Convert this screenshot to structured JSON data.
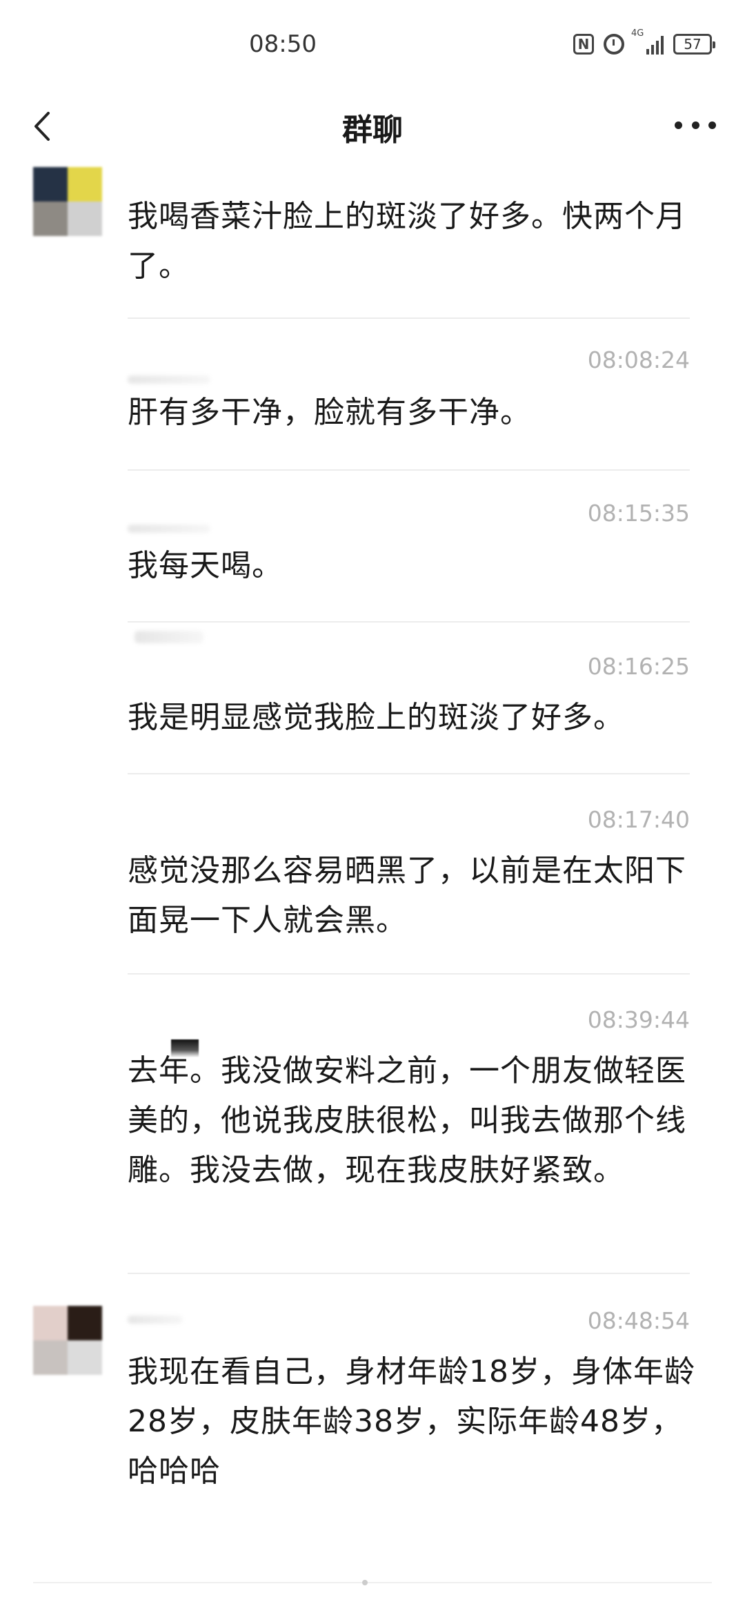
{
  "status_bar": {
    "time": "08:50",
    "nfc_label": "N",
    "network_label": "4G",
    "battery": "57"
  },
  "nav": {
    "title": "群聊",
    "back_icon": "chevron-left-icon",
    "more_icon": "more-dots-icon"
  },
  "messages": [
    {
      "time": "",
      "text": "我喝香菜汁脸上的斑淡了好多。快两个月了。",
      "avatar_colors": [
        "#253245",
        "#e3d64a",
        "#8e8a84",
        "#d0d0d0"
      ]
    },
    {
      "time": "08:08:24",
      "text": "肝有多干净，脸就有多干净。"
    },
    {
      "time": "08:15:35",
      "text": "我每天喝。"
    },
    {
      "time": "08:16:25",
      "text": "我是明显感觉我脸上的斑淡了好多。"
    },
    {
      "time": "08:17:40",
      "text": "感觉没那么容易晒黑了，以前是在太阳下面晃一下人就会黑。"
    },
    {
      "time": "08:39:44",
      "text": "去年。我没做安料之前，一个朋友做轻医美的，他说我皮肤很松，叫我去做那个线雕。我没去做，现在我皮肤好紧致。"
    },
    {
      "time": "08:48:54",
      "text": "我现在看自己，身材年龄18岁，身体年龄28岁，皮肤年龄38岁，实际年龄48岁，哈哈哈",
      "avatar_colors": [
        "#e2cfca",
        "#2a1d17",
        "#c8c2bf",
        "#dcdcdc"
      ]
    }
  ],
  "colors": {
    "timestamp": "#b2b2b2",
    "text": "#191919",
    "divider": "#ececec"
  }
}
